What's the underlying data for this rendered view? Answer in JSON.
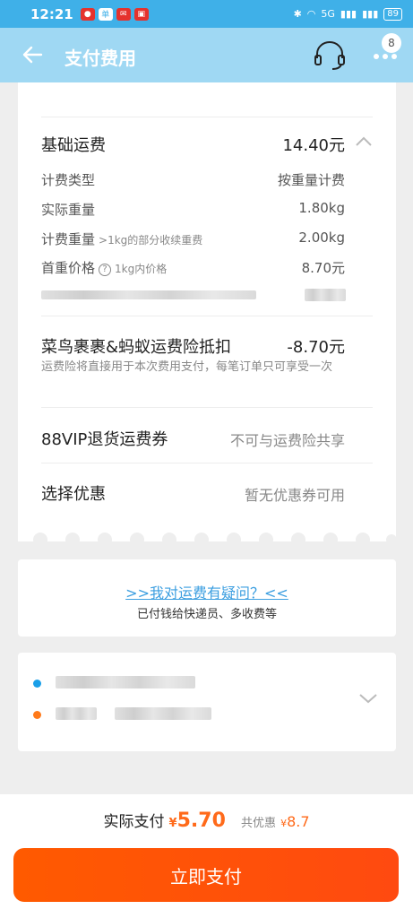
{
  "status_bar": {
    "time": "12:21",
    "battery": "89",
    "network": "5G"
  },
  "nav": {
    "title": "支付费用",
    "badge_count": "8"
  },
  "freight": {
    "label": "基础运费",
    "amount": "14.40元",
    "details": [
      {
        "label": "计费类型",
        "hint": "",
        "value": "按重量计费"
      },
      {
        "label": "实际重量",
        "hint": "",
        "value": "1.80kg"
      },
      {
        "label": "计费重量",
        "hint": ">1kg的部分收续重费",
        "value": "2.00kg"
      },
      {
        "label": "首重价格",
        "hint": "1kg内价格",
        "value": "8.70元"
      }
    ]
  },
  "insurance": {
    "label": "菜鸟裹裹&蚂蚁运费险抵扣",
    "amount": "-8.70元",
    "description": "运费险将直接用于本次费用支付，每笔订单只可享受一次"
  },
  "vip_coupon": {
    "label": "88VIP退货运费券",
    "status": "不可与运费险共享"
  },
  "discount": {
    "label": "选择优惠",
    "status": "暂无优惠券可用"
  },
  "question": {
    "link": ">>我对运费有疑问？<<",
    "subtitle": "已付钱给快递员、多收费等"
  },
  "payment": {
    "label": "实际支付",
    "currency": "¥",
    "amount": "5.70",
    "discount_label": "共优惠",
    "discount_amount": "8.7",
    "button": "立即支付"
  },
  "colors": {
    "accent": "#ff5a00",
    "header": "#9fd8f3",
    "link": "#3b9ee0",
    "sender_dot": "#1a9fe8",
    "receiver_dot": "#ff7a1a"
  }
}
